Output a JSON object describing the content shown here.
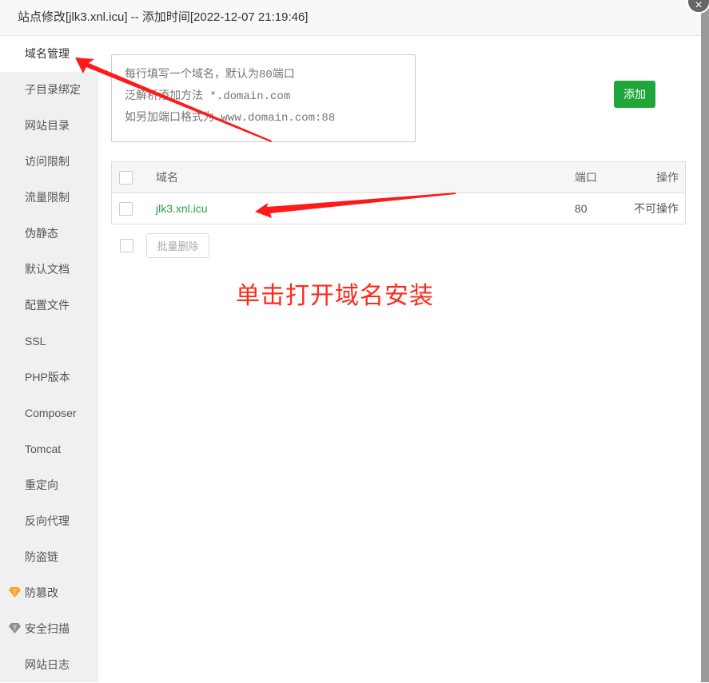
{
  "dialog": {
    "title": "站点修改[jlk3.xnl.icu] -- 添加时间[2022-12-07 21:19:46]",
    "close_icon": "×"
  },
  "sidebar": {
    "items": [
      {
        "label": "域名管理",
        "active": true
      },
      {
        "label": "子目录绑定"
      },
      {
        "label": "网站目录"
      },
      {
        "label": "访问限制"
      },
      {
        "label": "流量限制"
      },
      {
        "label": "伪静态"
      },
      {
        "label": "默认文档"
      },
      {
        "label": "配置文件"
      },
      {
        "label": "SSL"
      },
      {
        "label": "PHP版本"
      },
      {
        "label": "Composer"
      },
      {
        "label": "Tomcat"
      },
      {
        "label": "重定向"
      },
      {
        "label": "反向代理"
      },
      {
        "label": "防盗链"
      },
      {
        "label": "防篡改",
        "icon": "gem-icon-gold"
      },
      {
        "label": "安全扫描",
        "icon": "gem-icon-gray"
      },
      {
        "label": "网站日志"
      }
    ]
  },
  "domain_form": {
    "placeholder": "每行填写一个域名，默认为80端口\n泛解析添加方法 *.domain.com\n如另加端口格式为 www.domain.com:88",
    "add_label": "添加"
  },
  "table": {
    "headers": {
      "domain": "域名",
      "port": "端口",
      "action": "操作"
    },
    "rows": [
      {
        "domain": "jlk3.xnl.icu",
        "port": "80",
        "action": "不可操作"
      }
    ],
    "batch_delete_label": "批量删除"
  },
  "annotation": {
    "text": "单击打开域名安装",
    "color": "#ff2a1a"
  },
  "colors": {
    "accent": "#20a53a",
    "gem_gold": "#f5a623",
    "gem_gray": "#8c8c8c"
  }
}
